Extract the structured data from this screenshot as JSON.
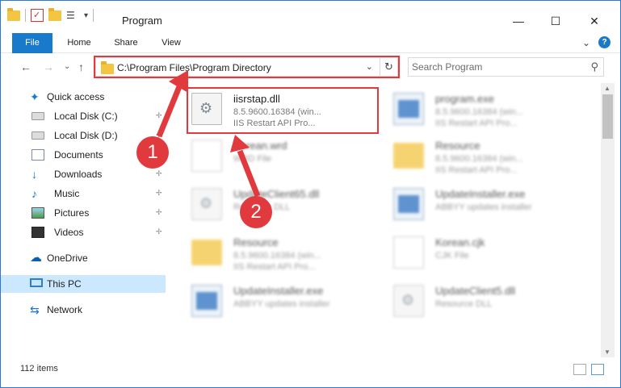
{
  "window": {
    "title": "Program",
    "controls": {
      "minimize": "—",
      "maximize": "☐",
      "close": "✕"
    }
  },
  "ribbon": {
    "tabs": [
      "File",
      "Home",
      "Share",
      "View"
    ],
    "chevron": "⌄",
    "help": "?"
  },
  "nav": {
    "back": "←",
    "forward": "→",
    "recent": "⌄",
    "up": "↑"
  },
  "address": {
    "path": "C:\\Program Files\\Program Directory",
    "dropdown": "⌄",
    "refresh": "↻"
  },
  "search": {
    "placeholder": "Search Program",
    "icon": "⚲"
  },
  "sidebar": {
    "items": [
      {
        "label": "Quick access",
        "icon": "star-icon",
        "root": true,
        "pinned": false
      },
      {
        "label": "Local Disk (C:)",
        "icon": "drive-icon",
        "root": false,
        "pinned": true
      },
      {
        "label": "Local Disk (D:)",
        "icon": "drive-icon",
        "root": false,
        "pinned": true
      },
      {
        "label": "Documents",
        "icon": "documents-icon",
        "root": false,
        "pinned": true
      },
      {
        "label": "Downloads",
        "icon": "downloads-icon",
        "root": false,
        "pinned": true
      },
      {
        "label": "Music",
        "icon": "music-icon",
        "root": false,
        "pinned": true
      },
      {
        "label": "Pictures",
        "icon": "pictures-icon",
        "root": false,
        "pinned": true
      },
      {
        "label": "Videos",
        "icon": "videos-icon",
        "root": false,
        "pinned": true
      },
      {
        "label": "OneDrive",
        "icon": "cloud-icon",
        "root": true,
        "pinned": false
      },
      {
        "label": "This PC",
        "icon": "computer-icon",
        "root": true,
        "pinned": false,
        "selected": true
      },
      {
        "label": "Network",
        "icon": "network-icon",
        "root": true,
        "pinned": false
      }
    ],
    "pin_glyph": "📌"
  },
  "files": [
    {
      "name": "iisrstap.dll",
      "meta1": "8.5.9600.16384 (win...",
      "meta2": "IIS Restart API Pro...",
      "icon": "dll-file-icon",
      "blurred": false
    },
    {
      "name": "program.exe",
      "meta1": "8.5.9600.16384 (win...",
      "meta2": "IIS Restart API Pro...",
      "icon": "exe-file-icon",
      "blurred": true
    },
    {
      "name": "Korean.wrd",
      "meta1": "WRD File",
      "meta2": "",
      "icon": "text-file-icon",
      "blurred": true
    },
    {
      "name": "Resource",
      "meta1": "8.5.9600.16384 (win...",
      "meta2": "IIS Restart API Pro...",
      "icon": "folder-icon",
      "blurred": true
    },
    {
      "name": "UpdateClient65.dll",
      "meta1": "Resource DLL",
      "meta2": "",
      "icon": "dll-file-icon",
      "blurred": true
    },
    {
      "name": "UpdateInstaller.exe",
      "meta1": "ABBYY updates installer",
      "meta2": "",
      "icon": "exe-file-icon",
      "blurred": true
    },
    {
      "name": "Resource",
      "meta1": "8.5.9600.16384 (win...",
      "meta2": "IIS Restart API Pro...",
      "icon": "folder-icon",
      "blurred": true
    },
    {
      "name": "Korean.cjk",
      "meta1": "CJK File",
      "meta2": "",
      "icon": "text-file-icon",
      "blurred": true
    },
    {
      "name": "UpdateInstaller.exe",
      "meta1": "ABBYY updates installer",
      "meta2": "",
      "icon": "exe-file-icon",
      "blurred": true
    },
    {
      "name": "UpdateClient5.dll",
      "meta1": "Resource DLL",
      "meta2": "",
      "icon": "dll-file-icon",
      "blurred": true
    }
  ],
  "status": {
    "item_count": "112 items"
  },
  "annotations": {
    "step1": "1",
    "step2": "2",
    "color": "#e0393e"
  },
  "colors": {
    "accent": "#1979ca",
    "selection": "#cce8ff",
    "highlight": "#e0393e"
  }
}
